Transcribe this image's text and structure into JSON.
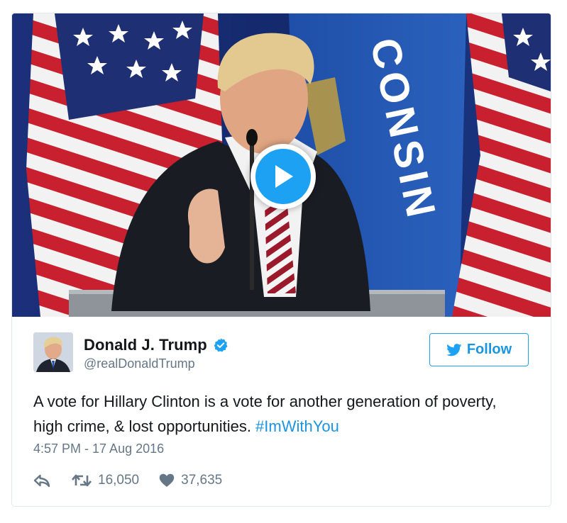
{
  "media": {
    "type": "video",
    "play_icon": "play-icon",
    "flag_text": "CONSIN"
  },
  "author": {
    "name": "Donald J. Trump",
    "handle": "@realDonaldTrump",
    "verified": true,
    "verified_icon": "verified-badge-icon"
  },
  "follow_button": {
    "label": "Follow",
    "icon": "twitter-bird-icon"
  },
  "tweet": {
    "text": "A vote for Hillary Clinton is a vote for another generation of poverty, high crime, & lost opportunities. ",
    "hashtag": "#ImWithYou",
    "timestamp": "4:57 PM - 17 Aug 2016"
  },
  "actions": {
    "reply_icon": "reply-icon",
    "retweet_icon": "retweet-icon",
    "retweet_count": "16,050",
    "like_icon": "heart-icon",
    "like_count": "37,635"
  },
  "colors": {
    "accent": "#1da1f2",
    "link": "#1b95e0",
    "muted": "#657786",
    "text": "#14171a",
    "border": "#e1e8ed"
  }
}
